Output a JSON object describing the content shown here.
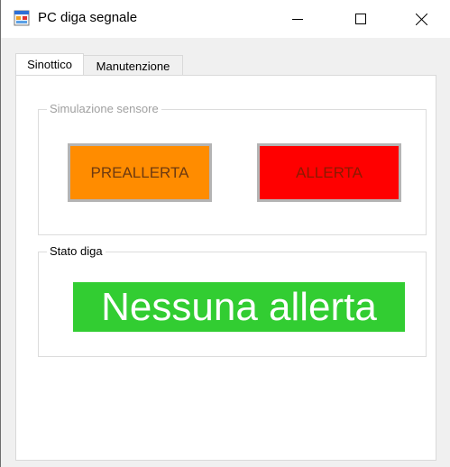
{
  "window": {
    "title": "PC diga segnale",
    "icon": "app-window-icon",
    "controls": [
      "minimize-icon",
      "maximize-icon",
      "close-icon"
    ]
  },
  "tabs": [
    {
      "label": "Sinottico",
      "active": true
    },
    {
      "label": "Manutenzione",
      "active": false
    }
  ],
  "sensor_group": {
    "title": "Simulazione sensore",
    "prealert_button": {
      "label": "PREALLERTA",
      "color": "#ff8c00"
    },
    "alert_button": {
      "label": "ALLERTA",
      "color": "#ff0000"
    }
  },
  "status_group": {
    "title": "Stato diga",
    "status_text": "Nessuna allerta",
    "status_color": "#32cd32"
  }
}
